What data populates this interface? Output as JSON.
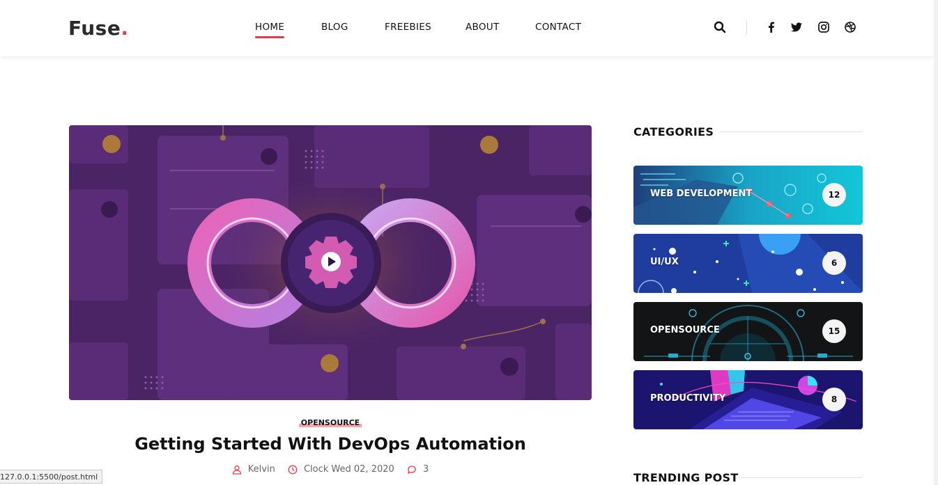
{
  "header": {
    "logo_text": "Fuse",
    "logo_dot": ".",
    "nav": [
      {
        "label": "HOME",
        "active": true
      },
      {
        "label": "BLOG",
        "active": false
      },
      {
        "label": "FREEBIES",
        "active": false
      },
      {
        "label": "ABOUT",
        "active": false
      },
      {
        "label": "CONTACT",
        "active": false
      }
    ],
    "icons": [
      "search-icon",
      "facebook-icon",
      "twitter-icon",
      "instagram-icon",
      "dribbble-icon"
    ]
  },
  "post": {
    "category": "OPENSOURCE",
    "title": "Getting Started With DevOps Automation",
    "author": "Kelvin",
    "date": "Clock Wed 02, 2020",
    "comments": "3"
  },
  "sidebar": {
    "categories_heading": "CATEGORIES",
    "categories": [
      {
        "label": "WEB DEVELOPMENT",
        "count": "12"
      },
      {
        "label": "UI/UX",
        "count": "6"
      },
      {
        "label": "OPENSOURCE",
        "count": "15"
      },
      {
        "label": "PRODUCTIVITY",
        "count": "8"
      }
    ],
    "trending_heading": "TRENDING POST"
  },
  "status_bar": {
    "url": "127.0.0.1:5500/post.html"
  },
  "colors": {
    "accent": "#e8384f",
    "hero_bg": "#4b2466"
  }
}
